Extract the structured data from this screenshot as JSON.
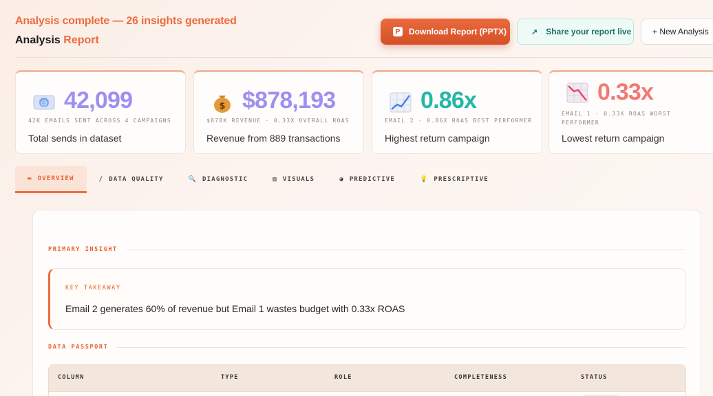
{
  "header": {
    "status": "Analysis complete — 26 insights generated",
    "title_main": "Analysis",
    "title_accent": "Report"
  },
  "actions": {
    "download": "Download Report (PPTX)",
    "download_badge": "P",
    "share": "Share your report live",
    "share_icon": "↗",
    "new": "+ New Analysis"
  },
  "kpis": [
    {
      "icon": "email-icon",
      "value": "42,099",
      "sub": "42K emails sent across 4 campaigns",
      "desc": "Total sends in dataset",
      "color": "#9f8ff0"
    },
    {
      "icon": "money-bag-icon",
      "value": "$878,193",
      "sub": "$878K revenue · 0.33x overall ROAS",
      "desc": "Revenue from 889 transactions",
      "color": "#9f8ff0"
    },
    {
      "icon": "chart-up-icon",
      "value": "0.86x",
      "sub": "Email 2 · 0.86x ROAS best performer",
      "desc": "Highest return campaign",
      "color": "#22b7a8"
    },
    {
      "icon": "chart-down-icon",
      "value": "0.33x",
      "sub": "Email 1 · 0.33x ROAS worst performer",
      "desc": "Lowest return campaign",
      "color": "#f27a74"
    }
  ],
  "tabs": [
    {
      "label": "OVERVIEW",
      "icon": "▬"
    },
    {
      "label": "DATA QUALITY",
      "icon": "∕"
    },
    {
      "label": "DIAGNOSTIC",
      "icon": "🔍"
    },
    {
      "label": "VISUALS",
      "icon": "▨"
    },
    {
      "label": "PREDICTIVE",
      "icon": "◕"
    },
    {
      "label": "PRESCRIPTIVE",
      "icon": "💡"
    }
  ],
  "panel": {
    "primary_label": "PRIMARY INSIGHT",
    "takeaway_label": "KEY TAKEAWAY",
    "takeaway_text": "Email 2 generates 60% of revenue but Email 1 wastes budget with 0.33x ROAS",
    "passport_label": "DATA PASSPORT",
    "columns": [
      "COLUMN",
      "TYPE",
      "ROLE",
      "COMPLETENESS",
      "STATUS"
    ]
  }
}
